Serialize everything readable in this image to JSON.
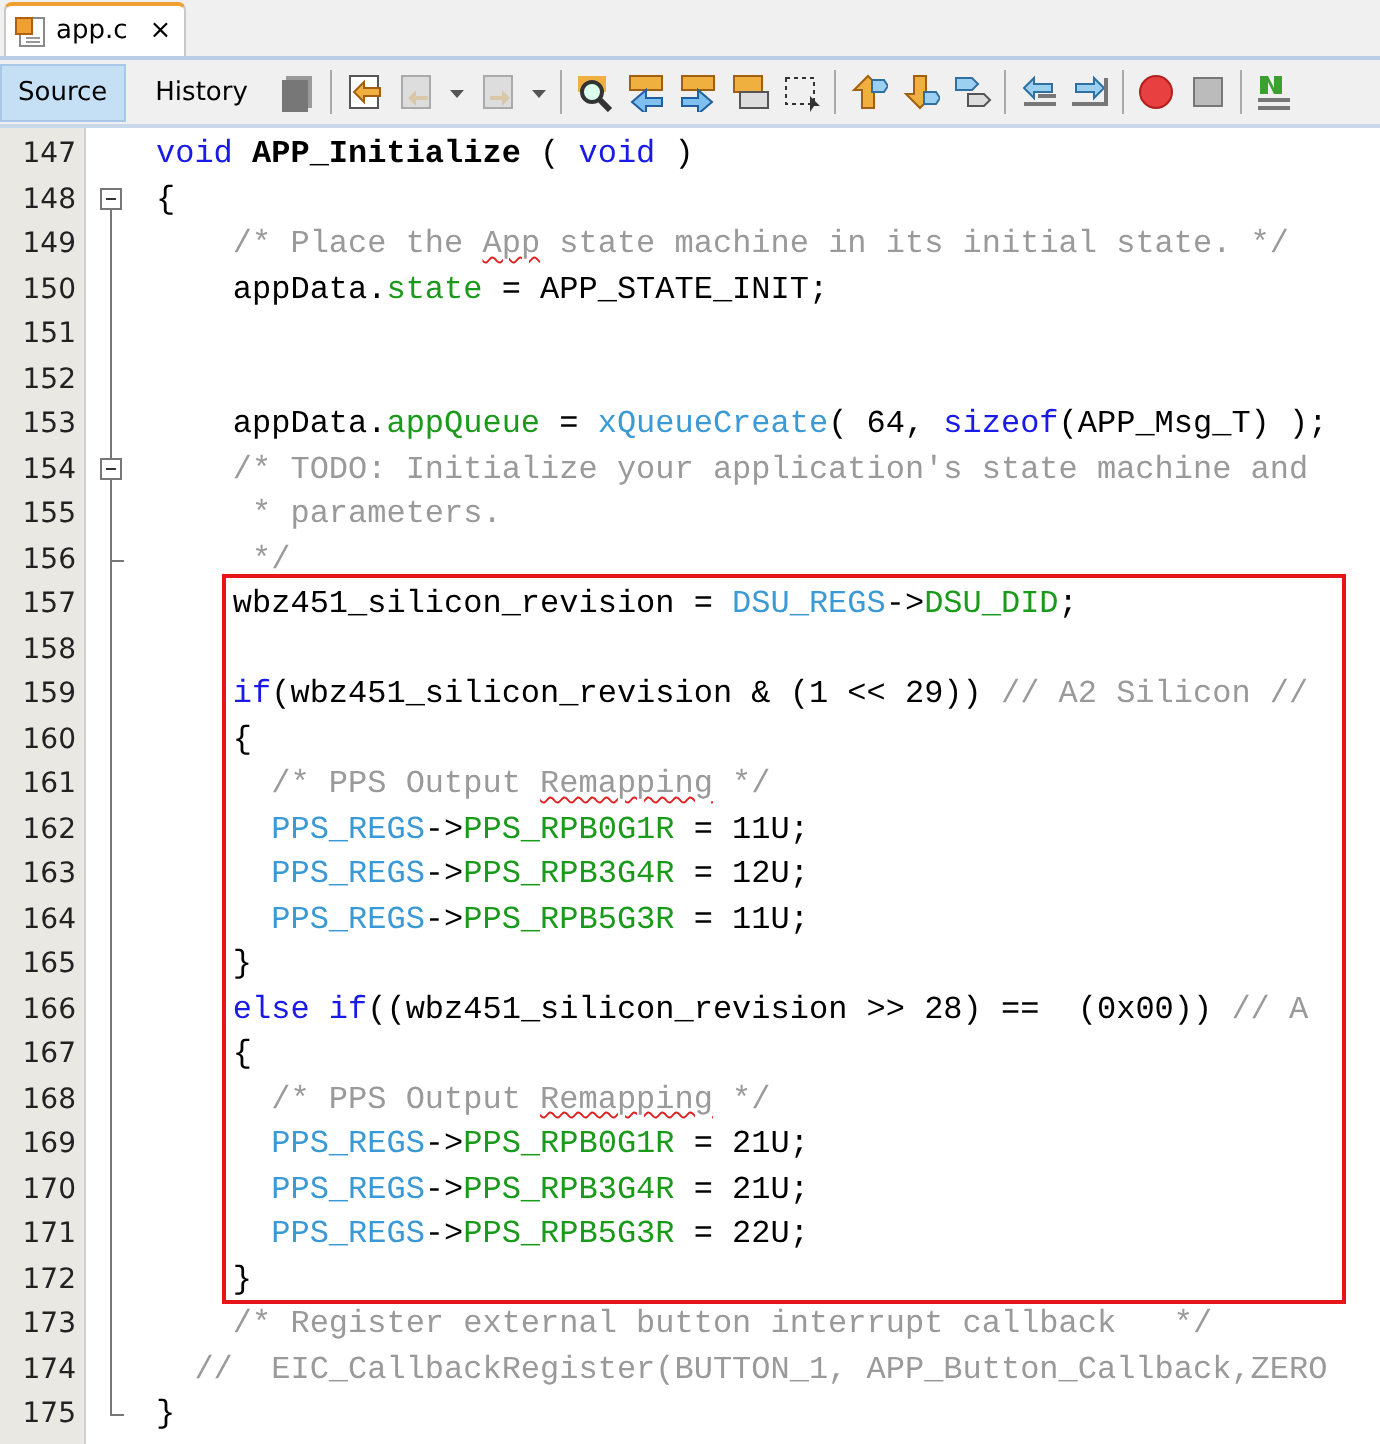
{
  "tab": {
    "label": "app.c",
    "close": "×"
  },
  "view_buttons": [
    {
      "label": "Source",
      "selected": true
    },
    {
      "label": "History",
      "selected": false
    }
  ],
  "editor": {
    "blocks": [
      {
        "framed": false,
        "lines": [
          {
            "number": "147",
            "collapsible": false,
            "fold_end": false,
            "tokens": [
              {
                "kind": "keyword",
                "text": "void"
              },
              {
                "kind": "bold",
                "text": " APP_Initialize"
              },
              {
                "kind": "plain",
                "text": " ( "
              },
              {
                "kind": "keyword",
                "text": "void"
              },
              {
                "kind": "plain",
                "text": " )"
              }
            ]
          },
          {
            "number": "148",
            "collapsible": true,
            "fold_end": false,
            "tokens": [
              {
                "kind": "plain",
                "text": "{"
              }
            ]
          },
          {
            "number": "149",
            "collapsible": false,
            "fold_end": false,
            "tokens": [
              {
                "kind": "comment",
                "text": "    /* Place the "
              },
              {
                "kind": "typo",
                "text": "App"
              },
              {
                "kind": "comment",
                "text": " state machine in its initial state. */"
              }
            ]
          },
          {
            "number": "150",
            "collapsible": false,
            "fold_end": false,
            "tokens": [
              {
                "kind": "plain",
                "text": "    appData."
              },
              {
                "kind": "field",
                "text": "state"
              },
              {
                "kind": "plain",
                "text": " = APP_STATE_INIT;"
              }
            ]
          },
          {
            "number": "151",
            "collapsible": false,
            "fold_end": false
          },
          {
            "number": "152",
            "collapsible": false,
            "fold_end": false
          },
          {
            "number": "153",
            "collapsible": false,
            "fold_end": false,
            "tokens": [
              {
                "kind": "plain",
                "text": "    appData."
              },
              {
                "kind": "field",
                "text": "appQueue"
              },
              {
                "kind": "plain",
                "text": " = "
              },
              {
                "kind": "macro",
                "text": "xQueueCreate"
              },
              {
                "kind": "plain",
                "text": "( 64, "
              },
              {
                "kind": "keyword",
                "text": "sizeof"
              },
              {
                "kind": "plain",
                "text": "(APP_Msg_T) );"
              }
            ]
          },
          {
            "number": "154",
            "collapsible": true,
            "fold_end": false,
            "tokens": [
              {
                "kind": "comment",
                "text": "    /* TODO: Initialize your application's state machine and"
              }
            ]
          },
          {
            "number": "155",
            "collapsible": false,
            "fold_end": false,
            "tokens": [
              {
                "kind": "comment",
                "text": "     * parameters."
              }
            ]
          },
          {
            "number": "156",
            "collapsible": false,
            "fold_end": true,
            "tokens": [
              {
                "kind": "comment",
                "text": "     */"
              }
            ]
          }
        ]
      },
      {
        "framed": true,
        "lines": [
          {
            "number": "157",
            "collapsible": false,
            "fold_end": false,
            "tokens": [
              {
                "kind": "plain",
                "text": "    wbz451_silicon_revision = "
              },
              {
                "kind": "macro",
                "text": "DSU_REGS"
              },
              {
                "kind": "plain",
                "text": "->"
              },
              {
                "kind": "field",
                "text": "DSU_DID"
              },
              {
                "kind": "plain",
                "text": ";"
              }
            ]
          },
          {
            "number": "158",
            "collapsible": false,
            "fold_end": false
          },
          {
            "number": "159",
            "collapsible": false,
            "fold_end": false,
            "tokens": [
              {
                "kind": "keyword",
                "text": "    if"
              },
              {
                "kind": "plain",
                "text": "(wbz451_silicon_revision & (1 << 29)) "
              },
              {
                "kind": "comment",
                "text": "// A2 Silicon //"
              }
            ]
          },
          {
            "number": "160",
            "collapsible": false,
            "fold_end": false,
            "tokens": [
              {
                "kind": "plain",
                "text": "    {"
              }
            ]
          },
          {
            "number": "161",
            "collapsible": false,
            "fold_end": false,
            "tokens": [
              {
                "kind": "comment",
                "text": "      /* PPS Output "
              },
              {
                "kind": "typo",
                "text": "Remapping"
              },
              {
                "kind": "comment",
                "text": " */"
              }
            ]
          },
          {
            "number": "162",
            "collapsible": false,
            "fold_end": false,
            "tokens": [
              {
                "kind": "macro",
                "text": "      PPS_REGS"
              },
              {
                "kind": "plain",
                "text": "->"
              },
              {
                "kind": "field",
                "text": "PPS_RPB0G1R"
              },
              {
                "kind": "plain",
                "text": " = 11U;"
              }
            ]
          },
          {
            "number": "163",
            "collapsible": false,
            "fold_end": false,
            "tokens": [
              {
                "kind": "macro",
                "text": "      PPS_REGS"
              },
              {
                "kind": "plain",
                "text": "->"
              },
              {
                "kind": "field",
                "text": "PPS_RPB3G4R"
              },
              {
                "kind": "plain",
                "text": " = 12U;"
              }
            ]
          },
          {
            "number": "164",
            "collapsible": false,
            "fold_end": false,
            "tokens": [
              {
                "kind": "macro",
                "text": "      PPS_REGS"
              },
              {
                "kind": "plain",
                "text": "->"
              },
              {
                "kind": "field",
                "text": "PPS_RPB5G3R"
              },
              {
                "kind": "plain",
                "text": " = 11U;"
              }
            ]
          },
          {
            "number": "165",
            "collapsible": false,
            "fold_end": false,
            "tokens": [
              {
                "kind": "plain",
                "text": "    }"
              }
            ]
          },
          {
            "number": "166",
            "collapsible": false,
            "fold_end": false,
            "tokens": [
              {
                "kind": "keyword",
                "text": "    else if"
              },
              {
                "kind": "plain",
                "text": "((wbz451_silicon_revision >> 28) ==  (0x00)) "
              },
              {
                "kind": "comment",
                "text": "// A"
              }
            ]
          },
          {
            "number": "167",
            "collapsible": false,
            "fold_end": false,
            "tokens": [
              {
                "kind": "plain",
                "text": "    {"
              }
            ]
          },
          {
            "number": "168",
            "collapsible": false,
            "fold_end": false,
            "tokens": [
              {
                "kind": "comment",
                "text": "      /* PPS Output "
              },
              {
                "kind": "typo",
                "text": "Remapping"
              },
              {
                "kind": "comment",
                "text": " */"
              }
            ]
          },
          {
            "number": "169",
            "collapsible": false,
            "fold_end": false,
            "tokens": [
              {
                "kind": "macro",
                "text": "      PPS_REGS"
              },
              {
                "kind": "plain",
                "text": "->"
              },
              {
                "kind": "field",
                "text": "PPS_RPB0G1R"
              },
              {
                "kind": "plain",
                "text": " = 21U;"
              }
            ]
          },
          {
            "number": "170",
            "collapsible": false,
            "fold_end": false,
            "tokens": [
              {
                "kind": "macro",
                "text": "      PPS_REGS"
              },
              {
                "kind": "plain",
                "text": "->"
              },
              {
                "kind": "field",
                "text": "PPS_RPB3G4R"
              },
              {
                "kind": "plain",
                "text": " = 21U;"
              }
            ]
          },
          {
            "number": "171",
            "collapsible": false,
            "fold_end": false,
            "tokens": [
              {
                "kind": "macro",
                "text": "      PPS_REGS"
              },
              {
                "kind": "plain",
                "text": "->"
              },
              {
                "kind": "field",
                "text": "PPS_RPB5G3R"
              },
              {
                "kind": "plain",
                "text": " = 22U;"
              }
            ]
          },
          {
            "number": "172",
            "collapsible": false,
            "fold_end": false,
            "tokens": [
              {
                "kind": "plain",
                "text": "    }"
              }
            ]
          }
        ]
      },
      {
        "framed": false,
        "lines": [
          {
            "number": "173",
            "collapsible": false,
            "fold_end": false,
            "tokens": [
              {
                "kind": "comment",
                "text": "    /* Register external button interrupt callback   */"
              }
            ]
          },
          {
            "number": "174",
            "collapsible": false,
            "fold_end": false,
            "tokens": [
              {
                "kind": "comment",
                "text": "  //  EIC_CallbackRegister(BUTTON_1, APP_Button_Callback,ZERO"
              }
            ]
          },
          {
            "number": "175",
            "collapsible": false,
            "fold_end": true,
            "tokens": [
              {
                "kind": "plain",
                "text": "}"
              }
            ]
          }
        ]
      }
    ]
  }
}
